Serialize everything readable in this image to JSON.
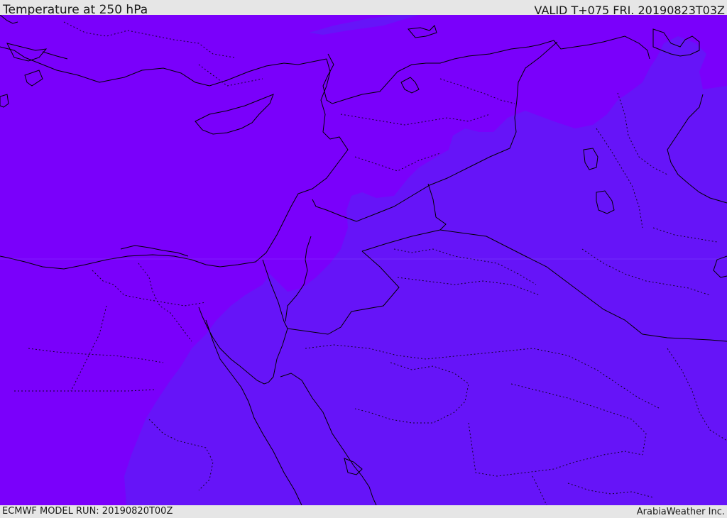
{
  "header": {
    "title": "Temperature at 250 hPa",
    "valid_time": "VALID T+075 FRI. 20190823T03Z"
  },
  "footer": {
    "model_run": "ECMWF MODEL RUN: 20190820T00Z",
    "credit": "ArabiaWeather Inc."
  },
  "map": {
    "colors": {
      "colder_region": "#7a00fb",
      "warmer_region": "#6614f8",
      "borders": "#000000"
    }
  }
}
